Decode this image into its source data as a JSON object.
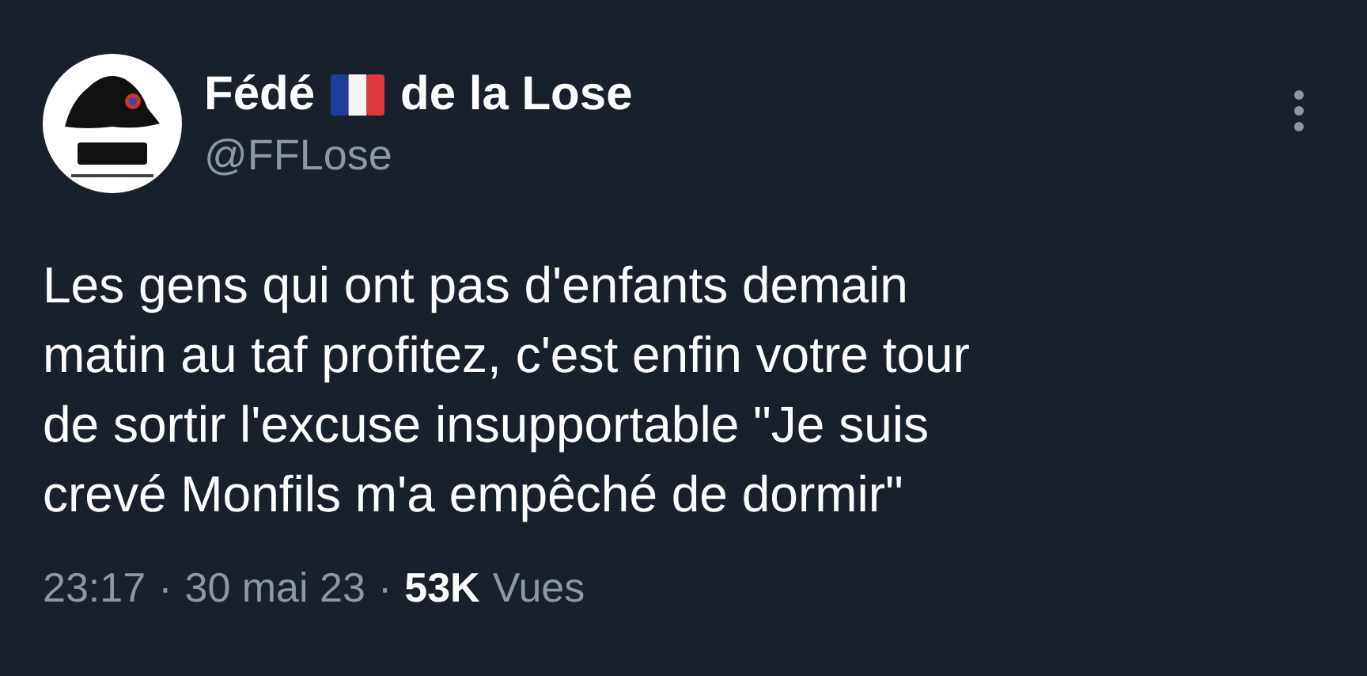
{
  "author": {
    "name_before_flag": "Fédé",
    "name_after_flag": "de la Lose",
    "handle": "@FFLose"
  },
  "tweet": {
    "lines": [
      "Les gens qui ont pas d'enfants demain",
      "matin au taf profitez, c'est enfin votre tour",
      "de sortir l'excuse insupportable \"Je suis",
      "crevé Monfils m'a empêché de dormir\""
    ]
  },
  "meta": {
    "time": "23:17",
    "separator_1": "·",
    "date": "30 mai 23",
    "separator_2": "·",
    "views_count": "53K",
    "views_label": "Vues"
  }
}
